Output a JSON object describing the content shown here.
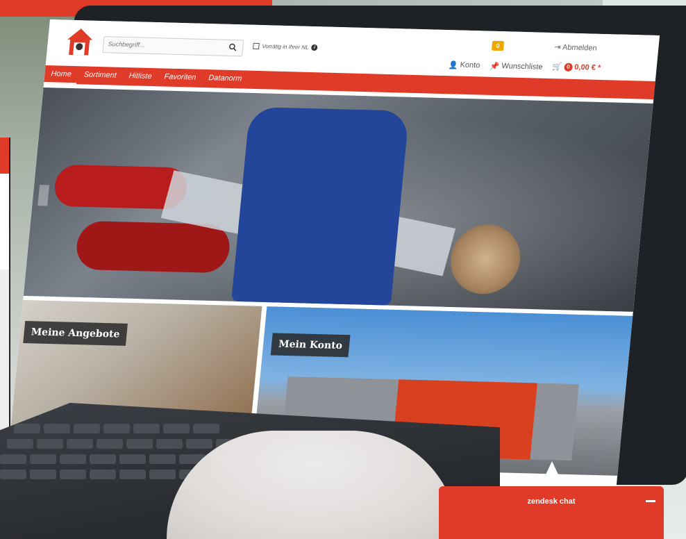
{
  "header": {
    "search_placeholder": "Suchbegriff...",
    "vorrat_label": "Vorrätig in Ihrer NL",
    "badge_value": "0",
    "abmelden": "Abmelden",
    "konto": "Konto",
    "wunschliste": "Wunschliste",
    "cart_count": "0",
    "cart_total": "0,00 € *"
  },
  "nav": {
    "items": [
      {
        "label": "Home"
      },
      {
        "label": "Sortiment"
      },
      {
        "label": "Hitliste"
      },
      {
        "label": "Favoriten"
      },
      {
        "label": "Datanorm"
      }
    ]
  },
  "tiles": {
    "tile1_label": "Meine Angebote",
    "tile2_label": "Mein Konto"
  },
  "chat": {
    "title": "zendesk chat"
  },
  "colors": {
    "brand_red": "#e03a28",
    "badge_orange": "#f0a800"
  }
}
